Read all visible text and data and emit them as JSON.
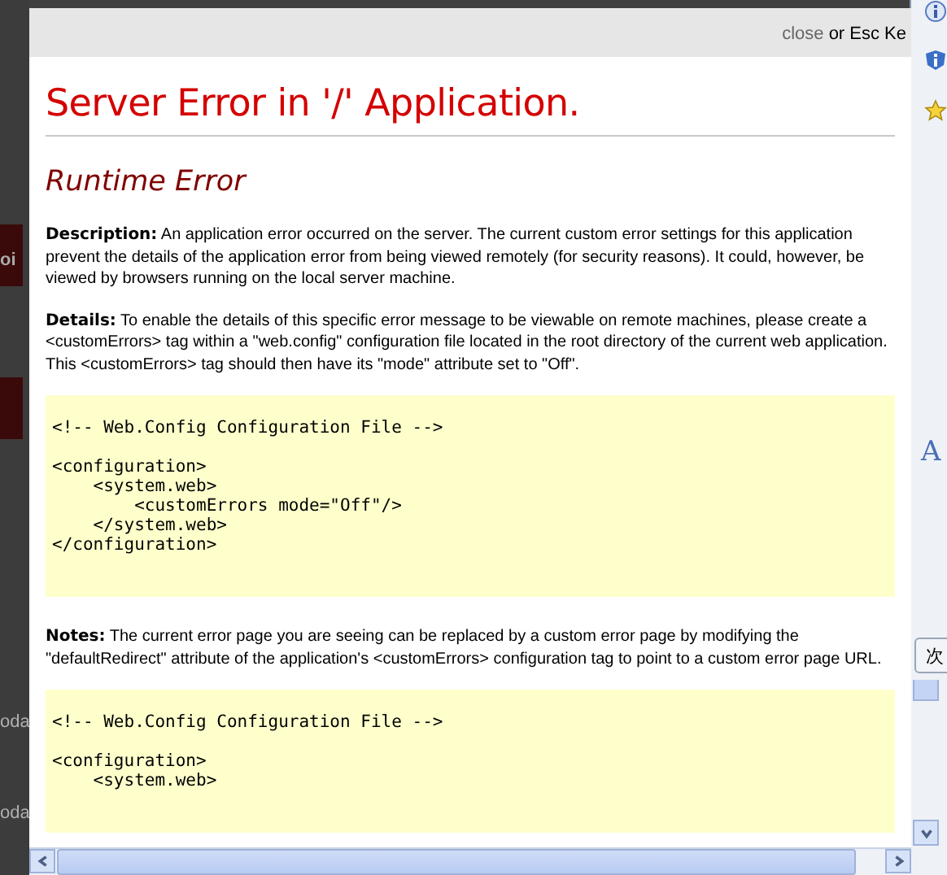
{
  "background": {
    "left_fragments": [
      "oi",
      "oda",
      "oda"
    ],
    "right_letter": "A",
    "right_tab": "次"
  },
  "dialog": {
    "close_link": "close",
    "close_hint": "or Esc Ke"
  },
  "error": {
    "title": "Server Error in '/' Application.",
    "subtitle": "Runtime Error",
    "sections": [
      {
        "kind": "text",
        "label": "Description:",
        "text": "An application error occurred on the server. The current custom error settings for this application prevent the details of the application error from being viewed remotely (for security reasons). It could, however, be viewed by browsers running on the local server machine."
      },
      {
        "kind": "text",
        "label": "Details:",
        "text": "To enable the details of this specific error message to be viewable on remote machines, please create a <customErrors> tag within a \"web.config\" configuration file located in the root directory of the current web application. This <customErrors> tag should then have its \"mode\" attribute set to \"Off\"."
      },
      {
        "kind": "code",
        "groups": [
          [
            "<!-- Web.Config Configuration File -->"
          ],
          [
            "<configuration>",
            "    <system.web>",
            "        <customErrors mode=\"Off\"/>",
            "    </system.web>",
            "</configuration>"
          ]
        ]
      },
      {
        "kind": "text",
        "label": "Notes:",
        "text": "The current error page you are seeing can be replaced by a custom error page by modifying the \"defaultRedirect\" attribute of the application's <customErrors> configuration tag to point to a custom error page URL."
      },
      {
        "kind": "code",
        "groups": [
          [
            "<!-- Web.Config Configuration File -->"
          ],
          [
            "<configuration>",
            "    <system.web>"
          ]
        ]
      }
    ]
  }
}
